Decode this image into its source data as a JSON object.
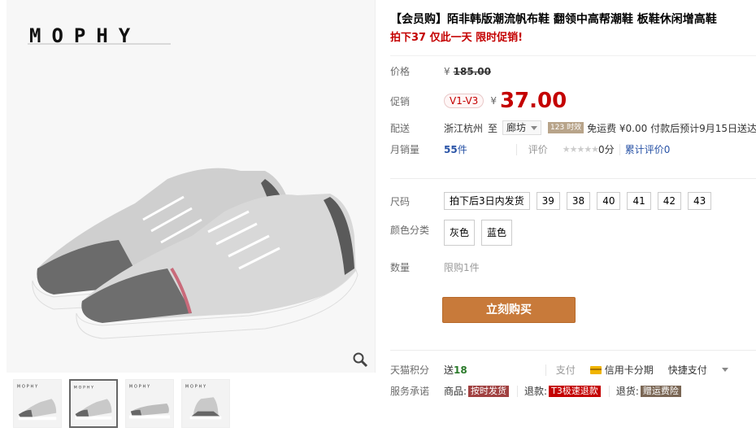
{
  "gallery": {
    "brand_text": "MOPHY",
    "thumbnails": [
      {
        "name": "thumb-1",
        "active": false,
        "logo": "MOPHY"
      },
      {
        "name": "thumb-2",
        "active": true,
        "logo": "MOPHY"
      },
      {
        "name": "thumb-3",
        "active": false,
        "logo": "MOPHY"
      },
      {
        "name": "thumb-4",
        "active": false,
        "logo": "MOPHY"
      }
    ],
    "zoom_icon": "magnifier-icon"
  },
  "product": {
    "title": "【会员购】陌非韩版潮流帆布鞋 翻领中高帮潮鞋 板鞋休闲增高鞋",
    "subtitle": "拍下37 仅此一天 限时促销!"
  },
  "price": {
    "label": "价格",
    "currency": "¥",
    "original": "185.00"
  },
  "promo": {
    "label": "促销",
    "tag": "V1-V3",
    "currency": "¥",
    "price": "37.00"
  },
  "delivery": {
    "label": "配送",
    "from": "浙江杭州",
    "to_word": "至",
    "destination": "廊坊",
    "time_badge": "123 时效",
    "shipping": "免运费 ¥0.00 付款后预计9月15日送达"
  },
  "sales": {
    "label": "月销量",
    "count": "55",
    "unit": "件",
    "rating_label": "评价",
    "stars": "★★★★★",
    "score": "0分",
    "review_text": "累计评价0"
  },
  "size": {
    "label": "尺码",
    "options": [
      "拍下后3日内发货",
      "39",
      "38",
      "40",
      "41",
      "42",
      "43"
    ]
  },
  "color": {
    "label": "颜色分类",
    "options": [
      "灰色",
      "蓝色"
    ]
  },
  "quantity": {
    "label": "数量",
    "limit": "限购1件"
  },
  "buy_button": "立刻购买",
  "tmall": {
    "points_label": "天猫积分",
    "points_prefix": "送",
    "points_value": "18",
    "pay_label": "支付",
    "pay_credit": "信用卡分期",
    "pay_quick": "快捷支付",
    "promise_label": "服务承诺",
    "promise_items": [
      {
        "prefix": "商品:",
        "tag": "按时发货"
      },
      {
        "prefix": "退款:",
        "tag": "T3极速退款"
      },
      {
        "prefix": "退货:",
        "tag": "赠运费险"
      }
    ]
  },
  "colors": {
    "accent_red": "#c40000",
    "buy_button": "#c87a3a",
    "link_blue": "#2953a6"
  }
}
